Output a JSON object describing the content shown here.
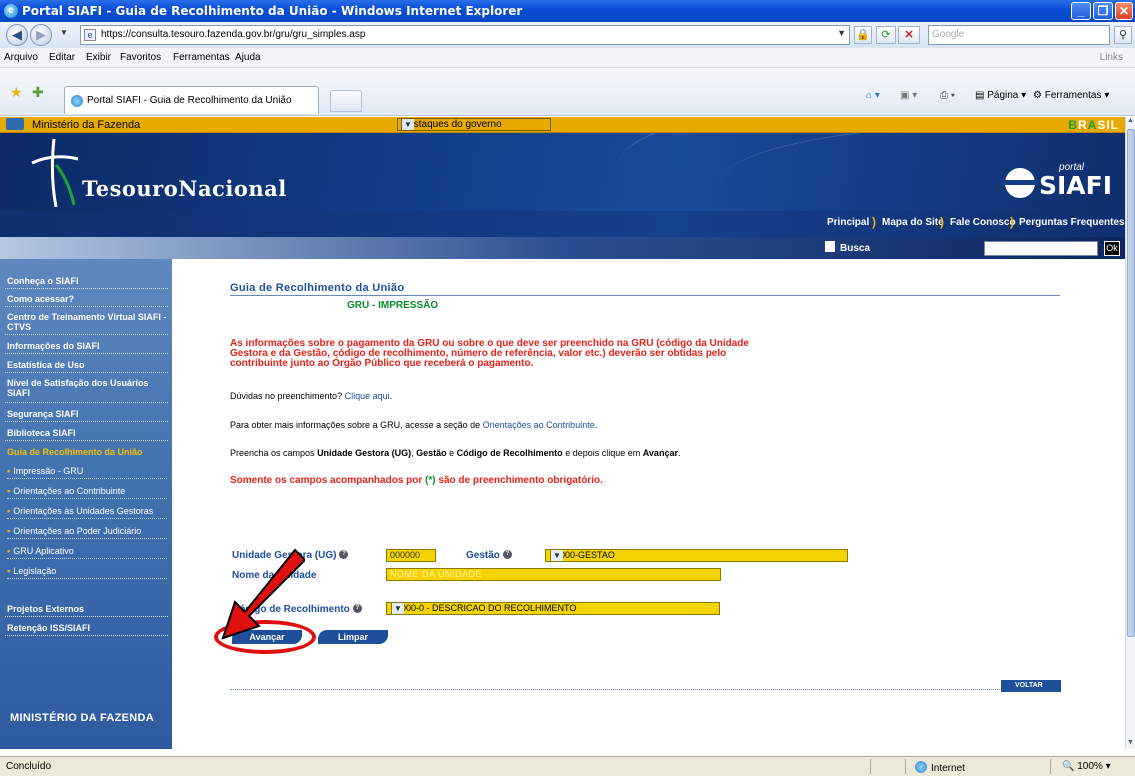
{
  "window": {
    "title": "Portal SIAFI - Guia de Recolhimento da União - Windows Internet Explorer",
    "url": "https://consulta.tesouro.fazenda.gov.br/gru/gru_simples.asp",
    "search_placeholder": "Google",
    "menu": [
      "Arquivo",
      "Editar",
      "Exibir",
      "Favoritos",
      "Ferramentas",
      "Ajuda"
    ],
    "links_label": "Links",
    "tab_title": "Portal SIAFI - Guia de Recolhimento da União",
    "cmd_pagina": "Página",
    "cmd_ferramentas": "Ferramentas",
    "status": "Concluído",
    "zone": "Internet",
    "zoom": "100%"
  },
  "gov_bar": {
    "ministry": "Ministério da Fazenda",
    "select_value": "Destaques do governo",
    "brasil_logo": "BRASIL"
  },
  "banner": {
    "brand": "TesouroNacional",
    "portal_label": "portal",
    "siafi": "SIAFI"
  },
  "top_links": [
    "Principal",
    "Mapa do Site",
    "Fale Conosco",
    "Perguntas Frequentes"
  ],
  "search": {
    "label": "Busca",
    "ok": "Ok"
  },
  "sidebar": {
    "items": [
      "Conheça o SIAFI",
      "Como acessar?",
      "Centro de Treinamento Virtual SIAFI - CTVS",
      "Informações do SIAFI",
      "Estatística de Uso",
      "Nível de Satisfação dos Usuários SIAFI",
      "Segurança SIAFI",
      "Biblioteca SIAFI",
      "Guia de Recolhimento da União"
    ],
    "subitems": [
      "Impressão - GRU",
      "Orientações ao Contribuinte",
      "Orientações às Unidades Gestoras",
      "Orientações ao Poder Judiciário",
      "GRU Aplicativo",
      "Legislação"
    ],
    "extra": [
      "Projetos Externos",
      "Retenção ISS/SIAFI"
    ],
    "footer": "MINISTÉRIO DA FAZENDA"
  },
  "content": {
    "title": "Guia de Recolhimento da União",
    "subtitle": "GRU - IMPRESSÃO",
    "warning": "As informações sobre o pagamento da GRU ou sobre o que deve ser preenchido na GRU (código da Unidade Gestora e da Gestão, código de recolhimento, número de referência, valor etc.) deverão ser obtidas pelo contribuinte junto ao Órgão Público que receberá o pagamento.",
    "duvidas_text": "Dúvidas no preenchimento?",
    "duvidas_link": "Clique aqui",
    "orient_text": "Para obter mais informações sobre a GRU, acesse a seção de",
    "orient_link": "Orientações ao Contribuinte",
    "preencha_1": "Preencha os campos",
    "preencha_ug": "Unidade Gestora (UG)",
    "preencha_sep1": ",",
    "preencha_gestao": "Gestão",
    "preencha_e": "e",
    "preencha_codigo": "Código de Recolhimento",
    "preencha_2": "e depois clique em",
    "preencha_avancar": "Avançar",
    "required": "Somente os campos acompanhados por",
    "required_mark": "(*)",
    "required_end": "são de preenchimento obrigatório."
  },
  "form": {
    "ug_label": "Unidade Gestora (UG)",
    "ug_value": "000000",
    "gestao_label": "Gestão",
    "gestao_value": "00000-GESTAO",
    "nome_label": "Nome da Unidade",
    "nome_placeholder": "NOME DA UNIDADE",
    "codigo_label": "Código de Recolhimento",
    "codigo_value": "00000-0 - DESCRICAO DO RECOLHIMENTO",
    "avancar": "Avançar",
    "limpar": "Limpar",
    "voltar": "VOLTAR"
  },
  "colors": {
    "accent": "#1e4ea0",
    "field_yellow": "#f4d400",
    "warning_red": "#e2231a",
    "annotation_red": "#e01010"
  }
}
